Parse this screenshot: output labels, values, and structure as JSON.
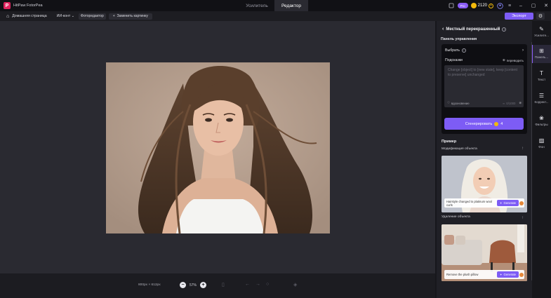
{
  "titlebar": {
    "app_name": "HitPaw FotorPea",
    "tabs": [
      {
        "label": "Усилитель",
        "active": false
      },
      {
        "label": "Редактор",
        "active": true
      }
    ],
    "pro_badge": "Pro",
    "coins": "2120"
  },
  "toolbar": {
    "home_label": "Домашняя страница",
    "ai_context": "ИИ-конт",
    "photo_editor": "Фоторедактор",
    "replace_label": "Заменить картинку",
    "export_label": "Экспорт"
  },
  "canvas": {
    "dimensions": "800px × 612px",
    "zoom": "57%"
  },
  "panel": {
    "title": "Местный перекрашенный",
    "control_label": "Панель управления",
    "select_label": "Выбрать",
    "prompt_label": "Подсказки",
    "translate_label": "переводить",
    "placeholder": "Change [object] to [new state], keep [content to preserve] unchanged",
    "inspiration_label": "вдохновение",
    "char_count": "0/1000",
    "generate_label": "Сгенерировать",
    "generate_cost": "4",
    "example_title": "Пример",
    "examples": [
      {
        "caption": "Модификация объекта",
        "overlay_text": "Hairstyle changed to platinum wool curls",
        "button": "Generate"
      },
      {
        "caption": "Удаление объекта",
        "overlay_text": "Remove the plush pillow",
        "button": "Generate"
      }
    ]
  },
  "rail": {
    "items": [
      {
        "label": "Усилите...",
        "active": false
      },
      {
        "label": "Панель...",
        "active": true
      },
      {
        "label": "Текст",
        "active": false
      },
      {
        "label": "Коррект...",
        "active": false
      },
      {
        "label": "Фильтры",
        "active": false
      },
      {
        "label": "Фон",
        "active": false
      }
    ]
  }
}
